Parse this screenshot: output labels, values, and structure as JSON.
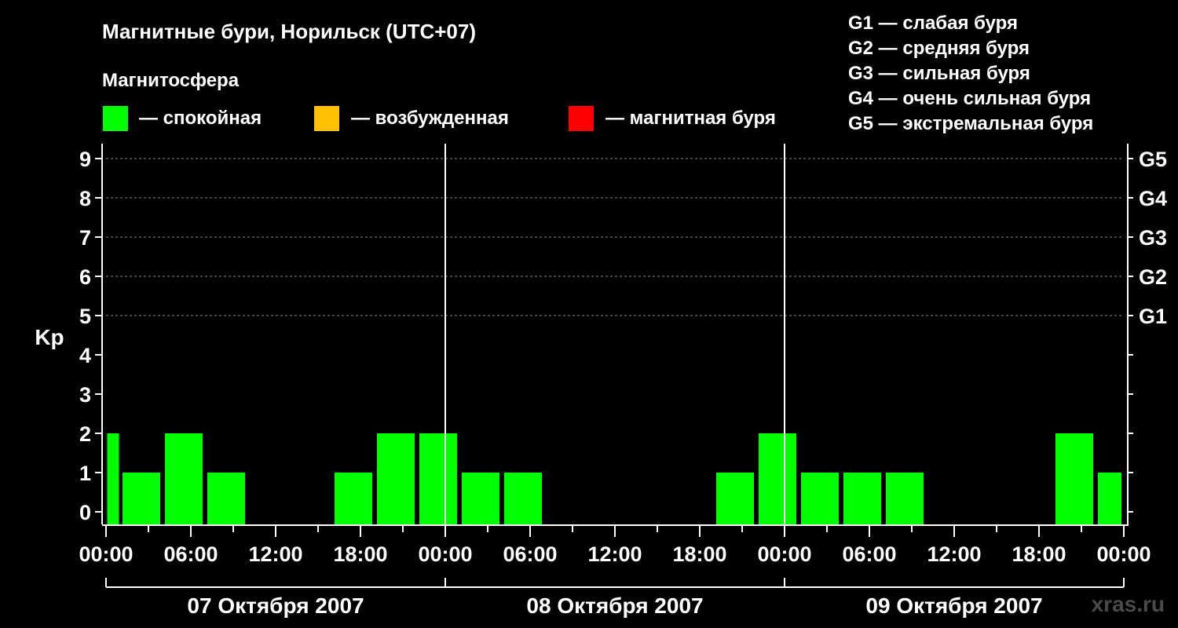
{
  "title": "Магнитные бури, Норильск (UTC+07)",
  "legend": {
    "heading": "Магнитосфера",
    "items": [
      {
        "label": "— спокойная",
        "color": "#00ff00"
      },
      {
        "label": "— возбужденная",
        "color": "#ffc000"
      },
      {
        "label": "— магнитная буря",
        "color": "#ff0000"
      }
    ]
  },
  "g_scale": [
    "G1 — слабая буря",
    "G2 — средняя буря",
    "G3 — сильная буря",
    "G4 — очень сильная буря",
    "G5 — экстремальная буря"
  ],
  "watermark": "xras.ru",
  "chart_data": {
    "type": "bar",
    "title": "Магнитные бури, Норильск (UTC+07)",
    "ylabel": "Kp",
    "ylim": [
      0,
      9
    ],
    "yticks": [
      "0",
      "1",
      "2",
      "3",
      "4",
      "5",
      "6",
      "7",
      "8",
      "9"
    ],
    "right_ticks": [
      {
        "kp": 5,
        "label": "G1"
      },
      {
        "kp": 6,
        "label": "G2"
      },
      {
        "kp": 7,
        "label": "G3"
      },
      {
        "kp": 8,
        "label": "G4"
      },
      {
        "kp": 9,
        "label": "G5"
      }
    ],
    "xticks": [
      "00:00",
      "06:00",
      "12:00",
      "18:00",
      "00:00",
      "06:00",
      "12:00",
      "18:00",
      "00:00",
      "06:00",
      "12:00",
      "18:00",
      "00:00"
    ],
    "days": [
      "07 Октября 2007",
      "08 Октября 2007",
      "09 Октября 2007"
    ],
    "bar_color": "#00ff00",
    "grid": "dashed horizontal at Kp 5–9",
    "bars": [
      {
        "start": "07 Октября 2007 00:00",
        "end": "07 Октября 2007 01:00",
        "kp": 2
      },
      {
        "start": "07 Октября 2007 01:00",
        "end": "07 Октября 2007 04:00",
        "kp": 1
      },
      {
        "start": "07 Октября 2007 04:00",
        "end": "07 Октября 2007 07:00",
        "kp": 2
      },
      {
        "start": "07 Октября 2007 07:00",
        "end": "07 Октября 2007 10:00",
        "kp": 1
      },
      {
        "start": "07 Октября 2007 10:00",
        "end": "07 Октября 2007 13:00",
        "kp": 0
      },
      {
        "start": "07 Октября 2007 13:00",
        "end": "07 Октября 2007 16:00",
        "kp": 0
      },
      {
        "start": "07 Октября 2007 16:00",
        "end": "07 Октября 2007 19:00",
        "kp": 1
      },
      {
        "start": "07 Октября 2007 19:00",
        "end": "07 Октября 2007 22:00",
        "kp": 2
      },
      {
        "start": "07 Октября 2007 22:00",
        "end": "08 Октября 2007 01:00",
        "kp": 2
      },
      {
        "start": "08 Октября 2007 01:00",
        "end": "08 Октября 2007 04:00",
        "kp": 1
      },
      {
        "start": "08 Октября 2007 04:00",
        "end": "08 Октября 2007 07:00",
        "kp": 1
      },
      {
        "start": "08 Октября 2007 07:00",
        "end": "08 Октября 2007 10:00",
        "kp": 0
      },
      {
        "start": "08 Октября 2007 10:00",
        "end": "08 Октября 2007 13:00",
        "kp": 0
      },
      {
        "start": "08 Октября 2007 13:00",
        "end": "08 Октября 2007 16:00",
        "kp": 0
      },
      {
        "start": "08 Октября 2007 16:00",
        "end": "08 Октября 2007 19:00",
        "kp": 0
      },
      {
        "start": "08 Октября 2007 19:00",
        "end": "08 Октября 2007 22:00",
        "kp": 1
      },
      {
        "start": "08 Октября 2007 22:00",
        "end": "09 Октября 2007 01:00",
        "kp": 2
      },
      {
        "start": "09 Октября 2007 01:00",
        "end": "09 Октября 2007 04:00",
        "kp": 1
      },
      {
        "start": "09 Октября 2007 04:00",
        "end": "09 Октября 2007 07:00",
        "kp": 1
      },
      {
        "start": "09 Октября 2007 07:00",
        "end": "09 Октября 2007 10:00",
        "kp": 1
      },
      {
        "start": "09 Октября 2007 10:00",
        "end": "09 Октября 2007 13:00",
        "kp": 0
      },
      {
        "start": "09 Октября 2007 13:00",
        "end": "09 Октября 2007 16:00",
        "kp": 0
      },
      {
        "start": "09 Октября 2007 16:00",
        "end": "09 Октября 2007 19:00",
        "kp": 0
      },
      {
        "start": "09 Октября 2007 19:00",
        "end": "09 Октября 2007 22:00",
        "kp": 2
      },
      {
        "start": "09 Октября 2007 22:00",
        "end": "10 Октября 2007 00:00",
        "kp": 1
      }
    ]
  }
}
